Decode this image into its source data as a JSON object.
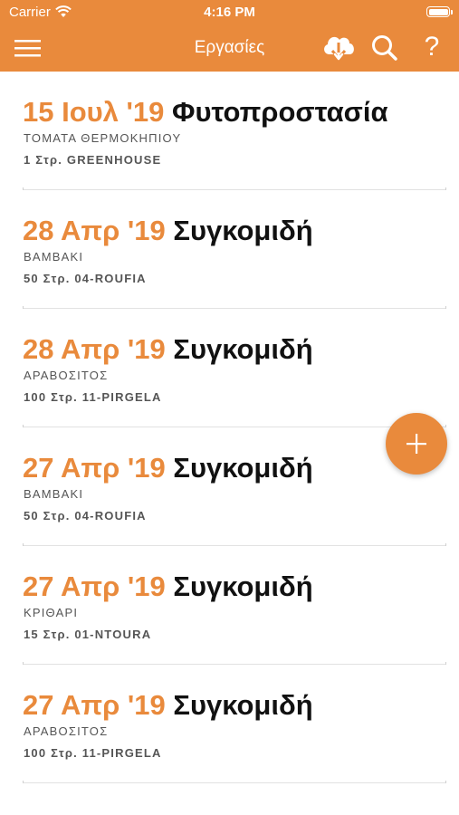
{
  "status_bar": {
    "carrier": "Carrier",
    "time": "4:16 PM",
    "icons": [
      "wifi-icon",
      "battery-icon"
    ]
  },
  "navbar": {
    "title": "Εργασίες",
    "icons": [
      "menu-icon",
      "cloud-download-icon",
      "search-icon"
    ],
    "help_label": "?"
  },
  "colors": {
    "accent": "#e98a3c",
    "text": "#111111",
    "subtext": "#555555"
  },
  "tasks": [
    {
      "date": "15 Ιουλ '19",
      "task": "Φυτοπροστασία",
      "crop": "ΤΟΜΑΤΑ ΘΕΡΜΟΚΗΠΙΟΥ",
      "field": "1 Στρ. GREENHOUSE"
    },
    {
      "date": "28 Απρ '19",
      "task": "Συγκομιδή",
      "crop": "ΒΑΜΒΑΚΙ",
      "field": "50 Στρ. 04-ROUFIA"
    },
    {
      "date": "28 Απρ '19",
      "task": "Συγκομιδή",
      "crop": "ΑΡΑΒΟΣΙΤΟΣ",
      "field": "100 Στρ. 11-PIRGELA"
    },
    {
      "date": "27 Απρ '19",
      "task": "Συγκομιδή",
      "crop": "ΒΑΜΒΑΚΙ",
      "field": "50 Στρ. 04-ROUFIA"
    },
    {
      "date": "27 Απρ '19",
      "task": "Συγκομιδή",
      "crop": "ΚΡΙΘΑΡΙ",
      "field": "15 Στρ. 01-NTOURA"
    },
    {
      "date": "27 Απρ '19",
      "task": "Συγκομιδή",
      "crop": "ΑΡΑΒΟΣΙΤΟΣ",
      "field": "100 Στρ. 11-PIRGELA"
    }
  ],
  "fab_icon": "plus-icon"
}
